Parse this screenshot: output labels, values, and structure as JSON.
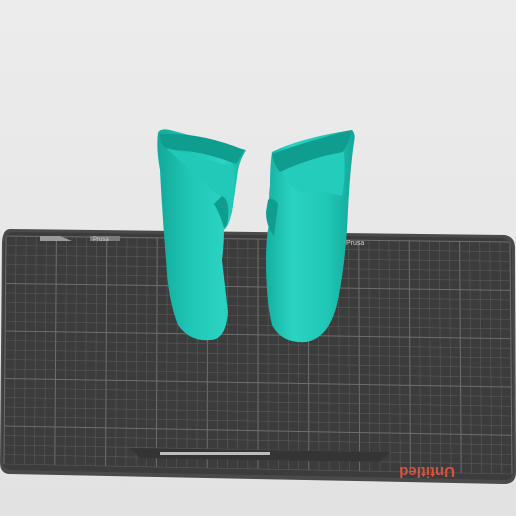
{
  "viewport": {
    "background": "#e6e6e6",
    "bed": {
      "surface_color": "#3c3c3c",
      "grid_color": "#5a5a5a",
      "grid_major_color": "#6e6e6e",
      "edge_color": "#4a4a4a",
      "logo_text": "Prusa",
      "logo_text_2": "Prusa",
      "brand_text": "Untitled",
      "logo_color": "#9a9a9a",
      "brand_color": "#d9523a"
    },
    "models": {
      "color": "#1fc6b5",
      "shade_color": "#12a899",
      "highlight_color": "#5ee0d2",
      "items": [
        {
          "name": "left-cup-model"
        },
        {
          "name": "right-cup-model"
        }
      ]
    }
  }
}
